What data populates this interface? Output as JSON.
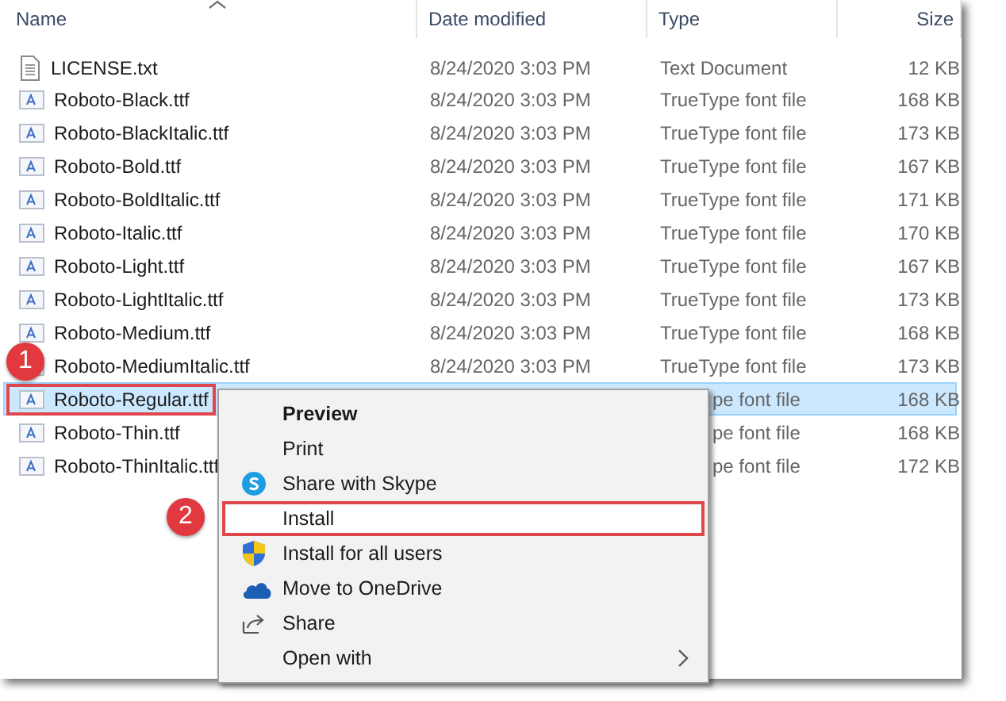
{
  "columns": [
    {
      "label": "Name",
      "sorted": true
    },
    {
      "label": "Date modified",
      "sorted": false
    },
    {
      "label": "Type",
      "sorted": false
    },
    {
      "label": "Size",
      "sorted": false
    }
  ],
  "rows": [
    {
      "kind": "text",
      "name": "LICENSE.txt",
      "date": "8/24/2020 3:03 PM",
      "type": "Text Document",
      "size": "12 KB",
      "selected": false
    },
    {
      "kind": "font",
      "name": "Roboto-Black.ttf",
      "date": "8/24/2020 3:03 PM",
      "type": "TrueType font file",
      "size": "168 KB",
      "selected": false
    },
    {
      "kind": "font",
      "name": "Roboto-BlackItalic.ttf",
      "date": "8/24/2020 3:03 PM",
      "type": "TrueType font file",
      "size": "173 KB",
      "selected": false
    },
    {
      "kind": "font",
      "name": "Roboto-Bold.ttf",
      "date": "8/24/2020 3:03 PM",
      "type": "TrueType font file",
      "size": "167 KB",
      "selected": false
    },
    {
      "kind": "font",
      "name": "Roboto-BoldItalic.ttf",
      "date": "8/24/2020 3:03 PM",
      "type": "TrueType font file",
      "size": "171 KB",
      "selected": false
    },
    {
      "kind": "font",
      "name": "Roboto-Italic.ttf",
      "date": "8/24/2020 3:03 PM",
      "type": "TrueType font file",
      "size": "170 KB",
      "selected": false
    },
    {
      "kind": "font",
      "name": "Roboto-Light.ttf",
      "date": "8/24/2020 3:03 PM",
      "type": "TrueType font file",
      "size": "167 KB",
      "selected": false
    },
    {
      "kind": "font",
      "name": "Roboto-LightItalic.ttf",
      "date": "8/24/2020 3:03 PM",
      "type": "TrueType font file",
      "size": "173 KB",
      "selected": false
    },
    {
      "kind": "font",
      "name": "Roboto-Medium.ttf",
      "date": "8/24/2020 3:03 PM",
      "type": "TrueType font file",
      "size": "168 KB",
      "selected": false
    },
    {
      "kind": "font",
      "name": "Roboto-MediumItalic.ttf",
      "date": "8/24/2020 3:03 PM",
      "type": "TrueType font file",
      "size": "173 KB",
      "selected": false
    },
    {
      "kind": "font",
      "name": "Roboto-Regular.ttf",
      "type": "pe font file",
      "size": "168 KB",
      "selected": true,
      "callout": "1"
    },
    {
      "kind": "font",
      "name": "Roboto-Thin.ttf",
      "type": "pe font file",
      "size": "168 KB",
      "selected": false
    },
    {
      "kind": "font",
      "name": "Roboto-ThinItalic.ttf",
      "type": "pe font file",
      "size": "172 KB",
      "selected": false
    }
  ],
  "context_menu": [
    {
      "kind": "plain",
      "label": "Preview",
      "default": true,
      "highlighted": false
    },
    {
      "kind": "plain",
      "label": "Print",
      "default": false,
      "highlighted": false
    },
    {
      "kind": "skype",
      "label": "Share with Skype",
      "default": false,
      "highlighted": false
    },
    {
      "kind": "plain",
      "label": "Install",
      "default": false,
      "highlighted": true,
      "callout": "2"
    },
    {
      "kind": "shield",
      "label": "Install for all users",
      "default": false,
      "highlighted": false
    },
    {
      "kind": "cloud",
      "label": "Move to OneDrive",
      "default": false,
      "highlighted": false
    },
    {
      "kind": "share",
      "label": "Share",
      "default": false,
      "highlighted": false
    },
    {
      "kind": "submenu",
      "label": "Open with",
      "default": false,
      "highlighted": false
    }
  ]
}
